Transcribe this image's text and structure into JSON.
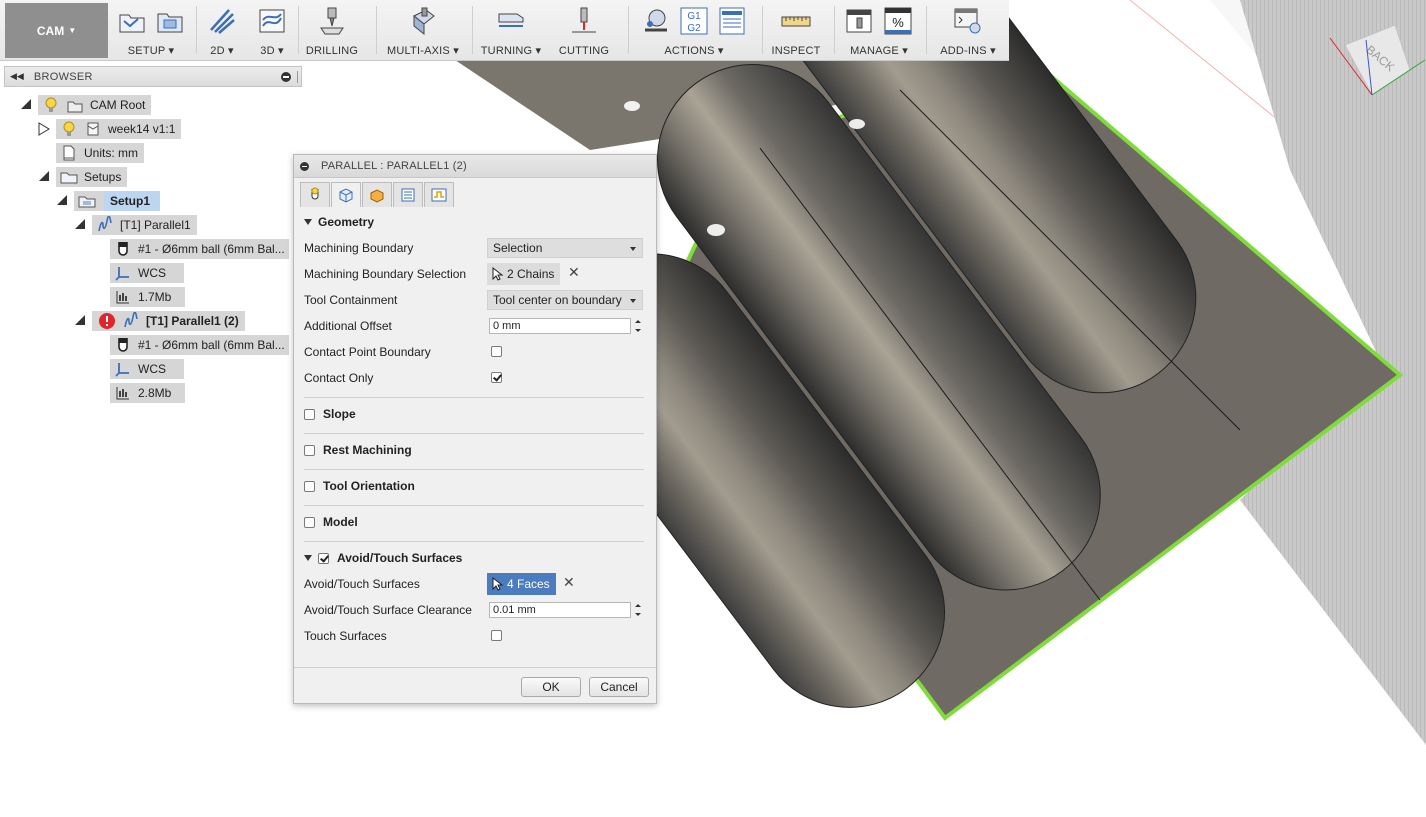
{
  "workspace": {
    "label": "CAM"
  },
  "toolbar": {
    "groups": [
      {
        "label": "SETUP",
        "dropdown": true
      },
      {
        "label": "2D",
        "dropdown": true
      },
      {
        "label": "3D",
        "dropdown": true
      },
      {
        "label": "DRILLING",
        "dropdown": false
      },
      {
        "label": "MULTI-AXIS",
        "dropdown": true
      },
      {
        "label": "TURNING",
        "dropdown": true
      },
      {
        "label": "CUTTING",
        "dropdown": false
      },
      {
        "label": "ACTIONS",
        "dropdown": true
      },
      {
        "label": "INSPECT",
        "dropdown": false
      },
      {
        "label": "MANAGE",
        "dropdown": true
      },
      {
        "label": "ADD-INS",
        "dropdown": true
      }
    ],
    "g1g2_text": "G1\nG2",
    "percent_text": "%"
  },
  "browser": {
    "title": "BROWSER",
    "nodes": {
      "cam_root": "CAM Root",
      "component": "week14 v1:1",
      "units": "Units: mm",
      "setups": "Setups",
      "setup1": "Setup1",
      "op1": "[T1] Parallel1",
      "op1_tool": "#1 - Ø6mm ball (6mm Bal...",
      "op1_wcs": "WCS",
      "op1_size": "1.7Mb",
      "op2": "[T1] Parallel1 (2)",
      "op2_tool": "#1 - Ø6mm ball (6mm Bal...",
      "op2_wcs": "WCS",
      "op2_size": "2.8Mb"
    }
  },
  "dialog": {
    "title": "PARALLEL : PARALLEL1 (2)",
    "geometry": {
      "heading": "Geometry",
      "machining_boundary_label": "Machining Boundary",
      "machining_boundary_value": "Selection",
      "boundary_selection_label": "Machining Boundary Selection",
      "boundary_selection_value": "2 Chains",
      "tool_containment_label": "Tool Containment",
      "tool_containment_value": "Tool center on boundary",
      "additional_offset_label": "Additional Offset",
      "additional_offset_value": "0 mm",
      "contact_point_boundary_label": "Contact Point Boundary",
      "contact_only_label": "Contact Only"
    },
    "sections": {
      "slope": "Slope",
      "rest_machining": "Rest Machining",
      "tool_orientation": "Tool Orientation",
      "model": "Model",
      "avoid_touch": "Avoid/Touch Surfaces"
    },
    "avoid": {
      "surfaces_label": "Avoid/Touch Surfaces",
      "surfaces_value": "4 Faces",
      "clearance_label": "Avoid/Touch Surface Clearance",
      "clearance_value": "0.01 mm",
      "touch_label": "Touch Surfaces"
    },
    "ok_label": "OK",
    "cancel_label": "Cancel"
  },
  "viewcube": {
    "face_label": "BACK"
  },
  "colors": {
    "selection_blue": "#4a7cbf",
    "stock_green": "#7fdc3a",
    "error_red": "#e0262b"
  }
}
